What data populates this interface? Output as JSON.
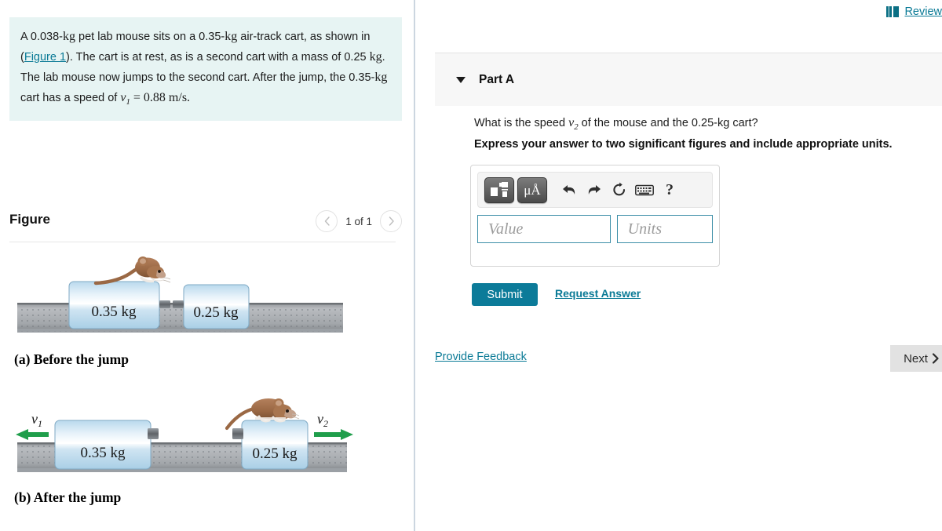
{
  "problem": {
    "text_parts": {
      "p1": "A 0.038-",
      "kg1": "kg",
      "p2": " pet lab mouse sits on a 0.35-",
      "kg2": "kg",
      "p3": " air-track cart, as shown in (",
      "figure_link": "Figure 1",
      "p4": "). The cart is at rest, as is a second cart with a mass of 0.25 ",
      "kg3": "kg",
      "p5": ". The lab mouse now jumps to the second cart. After the jump, the 0.35-",
      "kg4": "kg",
      "p6": " cart has a speed of ",
      "v1_var": "v",
      "v1_sub": "1",
      "p7": " = 0.88 m/s."
    }
  },
  "figure_panel": {
    "title": "Figure",
    "pager": {
      "prev_icon": "chevron-left-icon",
      "label": "1 of 1",
      "next_icon": "chevron-right-icon"
    },
    "diagram_a": {
      "caption": "(a) Before the jump",
      "cart1_label": "0.35 kg",
      "cart2_label": "0.25 kg"
    },
    "diagram_b": {
      "caption": "(b) After the jump",
      "cart1_label": "0.35 kg",
      "cart2_label": "0.25 kg",
      "v1_label": "v",
      "v1_sub": "1",
      "v2_label": "v",
      "v2_sub": "2",
      "arrow_color": "#1f9e4b"
    }
  },
  "right": {
    "review": {
      "icon": "book-icon",
      "label": "Review"
    },
    "part": {
      "caret_icon": "caret-down-icon",
      "title": "Part A"
    },
    "question": {
      "q_pre": "What is the speed ",
      "q_var": "v",
      "q_sub": "2",
      "q_post": " of the mouse and the 0.25-",
      "q_kg": "kg",
      "q_end": " cart?",
      "instruction": "Express your answer to two significant figures and include appropriate units."
    },
    "answer_toolbar": {
      "template_icon": "math-template-icon",
      "units_icon": "micro-angstrom-icon",
      "units_label": "μÅ",
      "undo_icon": "undo-icon",
      "redo_icon": "redo-icon",
      "reset_icon": "reset-icon",
      "keyboard_icon": "keyboard-icon",
      "help_icon": "help-icon",
      "help_label": "?"
    },
    "answer_fields": {
      "value_placeholder": "Value",
      "units_placeholder": "Units",
      "value": "",
      "units": ""
    },
    "submit_label": "Submit",
    "request_answer_label": "Request Answer",
    "provide_feedback_label": "Provide Feedback",
    "next_label": "Next",
    "next_icon": "chevron-right-icon"
  },
  "colors": {
    "accent_teal": "#0a7a96",
    "submit_bg": "#0c7b99",
    "problem_bg": "#e7f4f3",
    "panel_header_bg": "#f7f7f7",
    "arrow_green": "#1f9e4b"
  }
}
